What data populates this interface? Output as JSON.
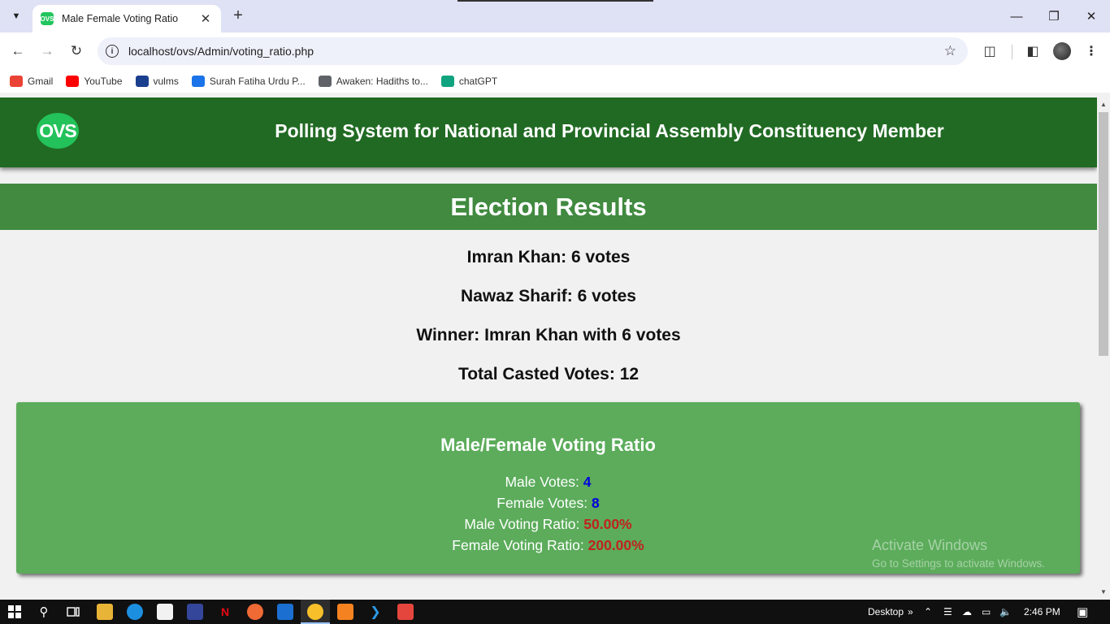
{
  "browser": {
    "tab_title": "Male Female Voting Ratio",
    "tab_favicon": "OVS",
    "url": "localhost/ovs/Admin/voting_ratio.php",
    "bookmarks": [
      {
        "label": "Gmail",
        "icon": "gmail-icon",
        "color": "#ea4335"
      },
      {
        "label": "YouTube",
        "icon": "youtube-icon",
        "color": "#ff0000"
      },
      {
        "label": "vulms",
        "icon": "vulms-icon",
        "color": "#1b3f8f"
      },
      {
        "label": "Surah Fatiha Urdu P...",
        "icon": "site-icon",
        "color": "#1a73e8"
      },
      {
        "label": "Awaken: Hadiths to...",
        "icon": "globe-icon",
        "color": "#5f6368"
      },
      {
        "label": "chatGPT",
        "icon": "chatgpt-icon",
        "color": "#10a37f"
      }
    ]
  },
  "header": {
    "logo_text": "OVS",
    "title": "Polling System for National and Provincial Assembly Constituency Member"
  },
  "results": {
    "heading": "Election Results",
    "lines": [
      "Imran Khan: 6 votes",
      "Nawaz Sharif: 6 votes",
      "Winner: Imran Khan with 6 votes",
      "Total Casted Votes: 12"
    ]
  },
  "ratio": {
    "title": "Male/Female Voting Ratio",
    "male_votes_label": "Male Votes:",
    "male_votes": "4",
    "female_votes_label": "Female Votes:",
    "female_votes": "8",
    "male_ratio_label": "Male Voting Ratio:",
    "male_ratio": "50.00%",
    "female_ratio_label": "Female Voting Ratio:",
    "female_ratio": "200.00%"
  },
  "watermark": {
    "title": "Activate Windows",
    "subtitle": "Go to Settings to activate Windows."
  },
  "taskbar": {
    "desktop_label": "Desktop",
    "time": "2:46 PM"
  },
  "colors": {
    "header_green": "#216a23",
    "banner_green": "#418a40",
    "card_green": "#5cac5b",
    "value_blue": "#0000dd",
    "value_red": "#c0221f"
  }
}
